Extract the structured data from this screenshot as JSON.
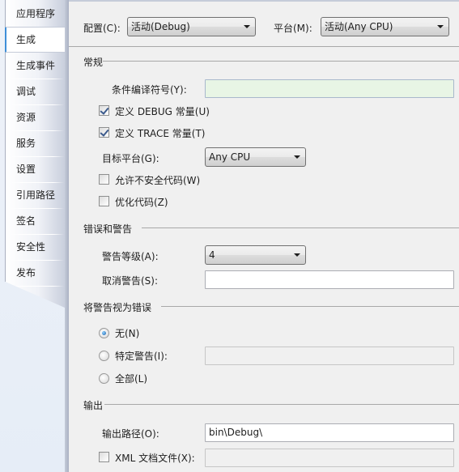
{
  "sidebar": {
    "tabs": [
      {
        "label": "应用程序",
        "active": false
      },
      {
        "label": "生成",
        "active": true
      },
      {
        "label": "生成事件",
        "active": false
      },
      {
        "label": "调试",
        "active": false
      },
      {
        "label": "资源",
        "active": false
      },
      {
        "label": "服务",
        "active": false
      },
      {
        "label": "设置",
        "active": false
      },
      {
        "label": "引用路径",
        "active": false
      },
      {
        "label": "签名",
        "active": false
      },
      {
        "label": "安全性",
        "active": false
      },
      {
        "label": "发布",
        "active": false
      }
    ]
  },
  "header": {
    "config_label": "配置(C):",
    "config_value": "活动(Debug)",
    "platform_label": "平台(M):",
    "platform_value": "活动(Any CPU)"
  },
  "general": {
    "title": "常规",
    "conditional_symbols_label": "条件编译符号(Y):",
    "conditional_symbols_value": "",
    "define_debug_label": "定义 DEBUG 常量(U)",
    "define_debug_checked": true,
    "define_trace_label": "定义 TRACE 常量(T)",
    "define_trace_checked": true,
    "target_platform_label": "目标平台(G):",
    "target_platform_value": "Any CPU",
    "allow_unsafe_label": "允许不安全代码(W)",
    "allow_unsafe_checked": false,
    "optimize_label": "优化代码(Z)",
    "optimize_checked": false
  },
  "errors": {
    "title": "错误和警告",
    "warning_level_label": "警告等级(A):",
    "warning_level_value": "4",
    "suppress_label": "取消警告(S):",
    "suppress_value": ""
  },
  "treat_as_errors": {
    "title": "将警告视为错误",
    "options": [
      {
        "label": "无(N)",
        "checked": true
      },
      {
        "label": "特定警告(I):",
        "checked": false
      },
      {
        "label": "全部(L)",
        "checked": false
      }
    ],
    "specific_value": ""
  },
  "output": {
    "title": "输出",
    "path_label": "输出路径(O):",
    "path_value": "bin\\Debug\\",
    "xml_doc_label": "XML 文档文件(X):",
    "xml_doc_checked": false,
    "xml_doc_value": ""
  },
  "colors": {
    "active_tab_accent": "#3f8fd8",
    "conditional_field_bg": "#e8f5e5"
  }
}
